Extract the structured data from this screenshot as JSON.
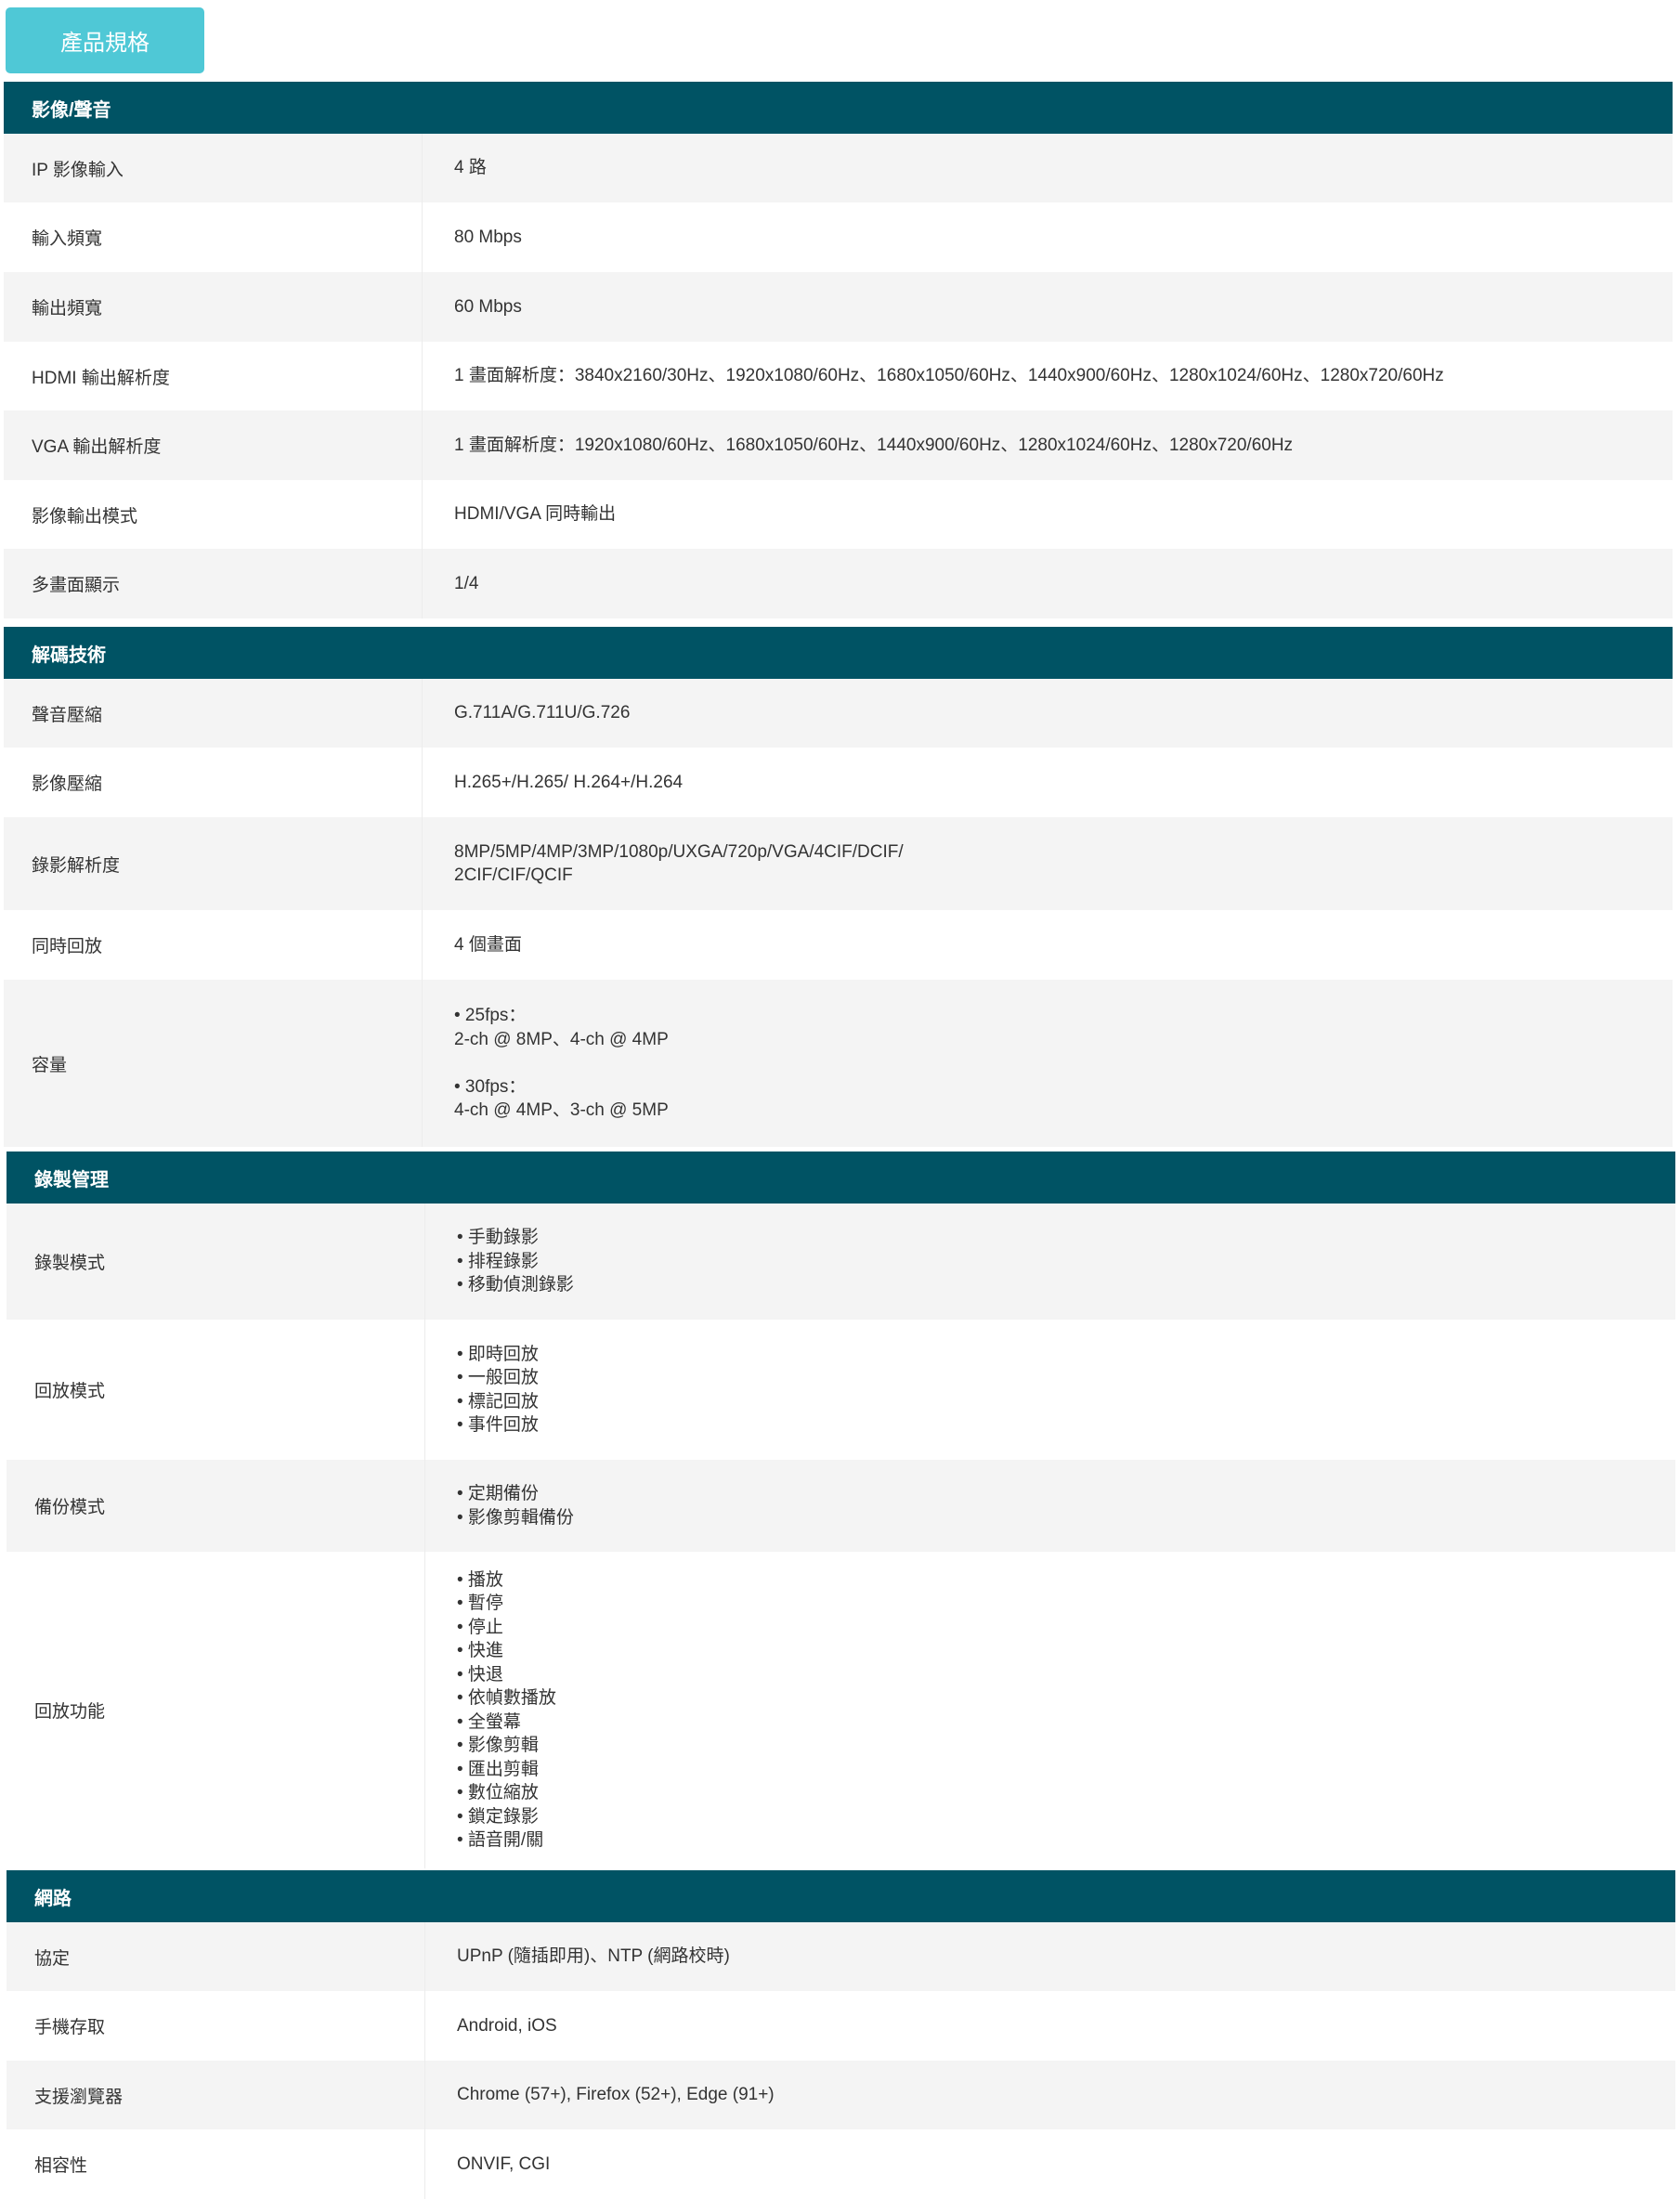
{
  "tab_label": "產品規格",
  "sections": {
    "video_audio": {
      "title": "影像/聲音",
      "rows": [
        {
          "label": "IP 影像輸入",
          "lines": [
            "4 路"
          ]
        },
        {
          "label": "輸入頻寬",
          "lines": [
            "80 Mbps"
          ]
        },
        {
          "label": "輸出頻寬",
          "lines": [
            "60 Mbps"
          ]
        },
        {
          "label": "HDMI 輸出解析度",
          "lines": [
            "1 畫面解析度：3840x2160/30Hz、1920x1080/60Hz、1680x1050/60Hz、1440x900/60Hz、1280x1024/60Hz、1280x720/60Hz"
          ]
        },
        {
          "label": "VGA 輸出解析度",
          "lines": [
            "1 畫面解析度：1920x1080/60Hz、1680x1050/60Hz、1440x900/60Hz、1280x1024/60Hz、1280x720/60Hz"
          ]
        },
        {
          "label": "影像輸出模式",
          "lines": [
            "HDMI/VGA 同時輸出"
          ]
        },
        {
          "label": "多畫面顯示",
          "lines": [
            "1/4"
          ]
        }
      ]
    },
    "decoding": {
      "title": "解碼技術",
      "rows": [
        {
          "label": "聲音壓縮",
          "lines": [
            "G.711A/G.711U/G.726"
          ]
        },
        {
          "label": "影像壓縮",
          "lines": [
            "H.265+/H.265/ H.264+/H.264"
          ]
        },
        {
          "label": "錄影解析度",
          "lines": [
            "8MP/5MP/4MP/3MP/1080p/UXGA/720p/VGA/4CIF/DCIF/",
            "2CIF/CIF/QCIF"
          ]
        },
        {
          "label": "同時回放",
          "lines": [
            "4 個畫面"
          ]
        },
        {
          "label": "容量",
          "lines": [
            "• 25fps：",
            "2-ch @ 8MP、4-ch @ 4MP",
            "",
            "• 30fps：",
            "4-ch @ 4MP、3-ch @ 5MP"
          ]
        }
      ]
    },
    "recording": {
      "title": "錄製管理",
      "rows": [
        {
          "label": "錄製模式",
          "lines": [
            "• 手動錄影",
            "• 排程錄影",
            "• 移動偵測錄影"
          ]
        },
        {
          "label": "回放模式",
          "lines": [
            "• 即時回放",
            "• 一般回放",
            "• 標記回放",
            "• 事件回放"
          ]
        },
        {
          "label": "備份模式",
          "lines": [
            "• 定期備份",
            "• 影像剪輯備份"
          ]
        },
        {
          "label": "回放功能",
          "lines": [
            "• 播放",
            "• 暫停",
            "• 停止",
            "• 快進",
            "• 快退",
            "• 依幀數播放",
            "• 全螢幕",
            "• 影像剪輯",
            "• 匯出剪輯",
            "• 數位縮放",
            "• 鎖定錄影",
            "• 語音開/關"
          ]
        }
      ]
    },
    "network": {
      "title": "網路",
      "rows": [
        {
          "label": "協定",
          "lines": [
            "UPnP (隨插即用)、NTP (網路校時)"
          ]
        },
        {
          "label": "手機存取",
          "lines": [
            "Android, iOS"
          ]
        },
        {
          "label": "支援瀏覽器",
          "lines": [
            "Chrome (57+), Firefox (52+), Edge (91+)"
          ]
        },
        {
          "label": "相容性",
          "lines": [
            "ONVIF, CGI"
          ]
        }
      ]
    }
  }
}
